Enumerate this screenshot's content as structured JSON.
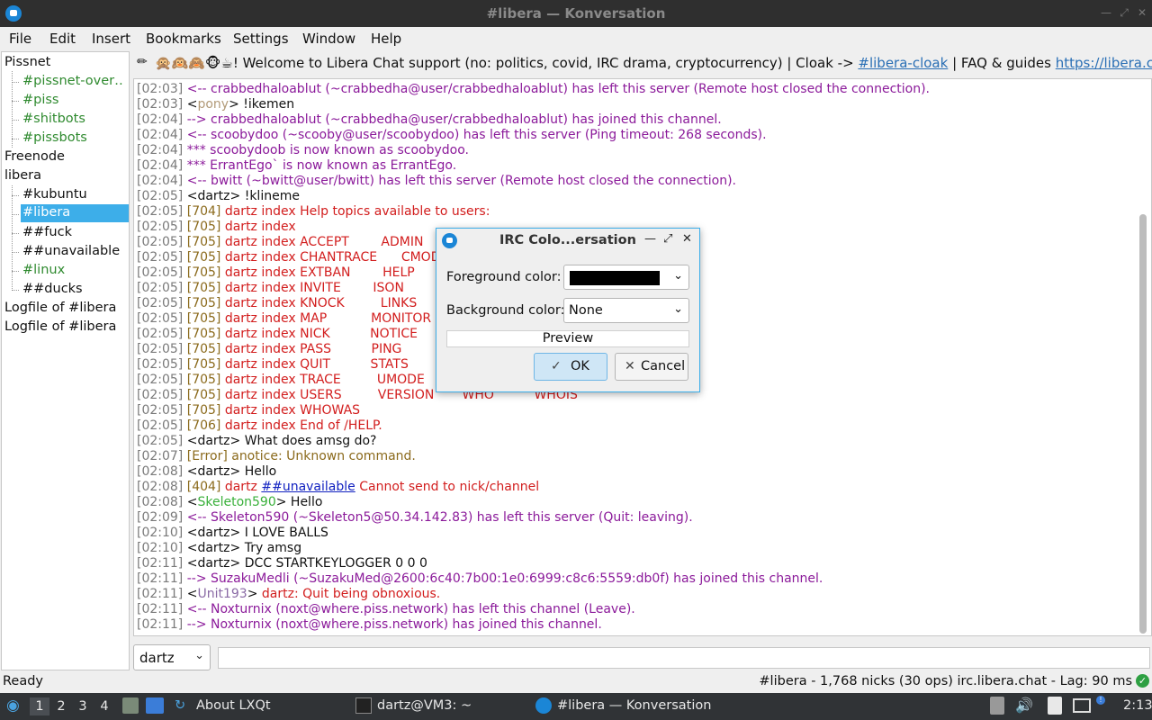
{
  "window": {
    "title": "#libera — Konversation"
  },
  "menu": [
    "File",
    "Edit",
    "Insert",
    "Bookmarks",
    "Settings",
    "Window",
    "Help"
  ],
  "tree": {
    "pissnet": "Pissnet",
    "pissnet_items": [
      "#pissnet-over…",
      "#piss",
      "#shitbots",
      "#pissbots"
    ],
    "freenode": "Freenode",
    "libera": "libera",
    "libera_items": [
      "#kubuntu",
      "#libera",
      "##fuck",
      "##unavailable",
      "#linux",
      "##ducks"
    ],
    "logfile1": "Logfile of #libera",
    "logfile2": "Logfile of #libera"
  },
  "topic": {
    "prefix": "🙊🙉🙈🐵☕! Welcome to Libera Chat support (no: politics, covid, IRC drama, cryptocurrency) | Cloak -> ",
    "cloak_link": "#libera-cloak",
    "middle": " | FAQ & guides ",
    "url": "https://libera.chat/guides/fa..."
  },
  "chat": [
    {
      "ts": "[02:03]",
      "segs": [
        {
          "t": "<-- crabbedhaloablut (~crabbedha@user/crabbedhaloablut) has left this server (Remote host closed the connection).",
          "c": "c-purple"
        }
      ]
    },
    {
      "ts": "[02:03]",
      "segs": [
        {
          "t": "<",
          "c": "c-black"
        },
        {
          "t": "pony",
          "c": "c-pony"
        },
        {
          "t": "> !ikemen",
          "c": "c-black"
        }
      ]
    },
    {
      "ts": "[02:04]",
      "segs": [
        {
          "t": "--> crabbedhaloablut (~crabbedha@user/crabbedhaloablut) has joined this channel.",
          "c": "c-purple"
        }
      ]
    },
    {
      "ts": "[02:04]",
      "segs": [
        {
          "t": "<-- scoobydoo (~scooby@user/scoobydoo) has left this server (Ping timeout: 268 seconds).",
          "c": "c-purple"
        }
      ]
    },
    {
      "ts": "[02:04]",
      "segs": [
        {
          "t": "*** scoobydoob is now known as scoobydoo.",
          "c": "c-purple"
        }
      ]
    },
    {
      "ts": "[02:04]",
      "segs": [
        {
          "t": "*** ErrantEgo` is now known as ErrantEgo.",
          "c": "c-purple"
        }
      ]
    },
    {
      "ts": "[02:04]",
      "segs": [
        {
          "t": "<-- bwitt (~bwitt@user/bwitt) has left this server (Remote host closed the connection).",
          "c": "c-purple"
        }
      ]
    },
    {
      "ts": "[02:05]",
      "segs": [
        {
          "t": "<dartz> !klineme",
          "c": "c-black"
        }
      ]
    },
    {
      "ts": "[02:05]",
      "segs": [
        {
          "t": "[704]",
          "c": "c-olive"
        },
        {
          "t": " dartz index Help topics available to users:",
          "c": "c-red"
        }
      ]
    },
    {
      "ts": "[02:05]",
      "segs": [
        {
          "t": "[705]",
          "c": "c-olive"
        },
        {
          "t": " dartz index",
          "c": "c-red"
        }
      ]
    },
    {
      "ts": "[02:05]",
      "segs": [
        {
          "t": "[705]",
          "c": "c-olive"
        },
        {
          "t": " dartz index ACCEPT        ADMIN",
          "c": "c-red"
        }
      ]
    },
    {
      "ts": "[02:05]",
      "segs": [
        {
          "t": "[705]",
          "c": "c-olive"
        },
        {
          "t": " dartz index CHANTRACE      CMODE",
          "c": "c-red"
        }
      ]
    },
    {
      "ts": "[02:05]",
      "segs": [
        {
          "t": "[705]",
          "c": "c-olive"
        },
        {
          "t": " dartz index EXTBAN        HELP",
          "c": "c-red"
        }
      ]
    },
    {
      "ts": "[02:05]",
      "segs": [
        {
          "t": "[705]",
          "c": "c-olive"
        },
        {
          "t": " dartz index INVITE        ISON",
          "c": "c-red"
        }
      ]
    },
    {
      "ts": "[02:05]",
      "segs": [
        {
          "t": "[705]",
          "c": "c-olive"
        },
        {
          "t": " dartz index KNOCK         LINKS",
          "c": "c-red"
        }
      ]
    },
    {
      "ts": "[02:05]",
      "segs": [
        {
          "t": "[705]",
          "c": "c-olive"
        },
        {
          "t": " dartz index MAP           MONITOR",
          "c": "c-red"
        }
      ]
    },
    {
      "ts": "[02:05]",
      "segs": [
        {
          "t": "[705]",
          "c": "c-olive"
        },
        {
          "t": " dartz index NICK          NOTICE",
          "c": "c-red"
        }
      ]
    },
    {
      "ts": "[02:05]",
      "segs": [
        {
          "t": "[705]",
          "c": "c-olive"
        },
        {
          "t": " dartz index PASS          PING",
          "c": "c-red"
        }
      ]
    },
    {
      "ts": "[02:05]",
      "segs": [
        {
          "t": "[705]",
          "c": "c-olive"
        },
        {
          "t": " dartz index QUIT          STATS",
          "c": "c-red"
        }
      ]
    },
    {
      "ts": "[02:05]",
      "segs": [
        {
          "t": "[705]",
          "c": "c-olive"
        },
        {
          "t": " dartz index TRACE         UMODE",
          "c": "c-red"
        }
      ]
    },
    {
      "ts": "[02:05]",
      "segs": [
        {
          "t": "[705]",
          "c": "c-olive"
        },
        {
          "t": " dartz index USERS         VERSION       WHO          WHOIS",
          "c": "c-red"
        }
      ]
    },
    {
      "ts": "[02:05]",
      "segs": [
        {
          "t": "[705]",
          "c": "c-olive"
        },
        {
          "t": " dartz index WHOWAS",
          "c": "c-red"
        }
      ]
    },
    {
      "ts": "[02:05]",
      "segs": [
        {
          "t": "[706]",
          "c": "c-olive"
        },
        {
          "t": " dartz index End of /HELP.",
          "c": "c-red"
        }
      ]
    },
    {
      "ts": "[02:05]",
      "segs": [
        {
          "t": "<dartz> What does amsg do?",
          "c": "c-black"
        }
      ]
    },
    {
      "ts": "[02:07]",
      "segs": [
        {
          "t": "[Error] anotice: Unknown command.",
          "c": "c-olive"
        }
      ]
    },
    {
      "ts": "[02:08]",
      "segs": [
        {
          "t": "<dartz> Hello",
          "c": "c-black"
        }
      ]
    },
    {
      "ts": "[02:08]",
      "segs": [
        {
          "t": "[404]",
          "c": "c-olive"
        },
        {
          "t": " dartz ",
          "c": "c-red"
        },
        {
          "t": "##unavailable",
          "c": "c-link"
        },
        {
          "t": " Cannot send to nick/channel",
          "c": "c-red"
        }
      ]
    },
    {
      "ts": "[02:08]",
      "segs": [
        {
          "t": "<",
          "c": "c-black"
        },
        {
          "t": "Skeleton590",
          "c": "c-green"
        },
        {
          "t": "> Hello",
          "c": "c-black"
        }
      ]
    },
    {
      "ts": "[02:09]",
      "segs": [
        {
          "t": "<-- Skeleton590 (~Skeleton5@50.34.142.83) has left this server (Quit: leaving).",
          "c": "c-purple"
        }
      ]
    },
    {
      "ts": "[02:10]",
      "segs": [
        {
          "t": "<dartz> I LOVE BALLS",
          "c": "c-black"
        }
      ]
    },
    {
      "ts": "[02:10]",
      "segs": [
        {
          "t": "<dartz> Try amsg",
          "c": "c-black"
        }
      ]
    },
    {
      "ts": "[02:11]",
      "segs": [
        {
          "t": "<dartz> DCC STARTKEYLOGGER 0 0 0",
          "c": "c-black"
        }
      ]
    },
    {
      "ts": "[02:11]",
      "segs": [
        {
          "t": "--> SuzakuMedli (~SuzakuMed@2600:6c40:7b00:1e0:6999:c8c6:5559:db0f) has joined this channel.",
          "c": "c-purple"
        }
      ]
    },
    {
      "ts": "[02:11]",
      "segs": [
        {
          "t": "<",
          "c": "c-black"
        },
        {
          "t": "Unit193",
          "c": "c-unit"
        },
        {
          "t": "> ",
          "c": "c-black"
        },
        {
          "t": "dartz: Quit being obnoxious.",
          "c": "c-red"
        }
      ]
    },
    {
      "ts": "[02:11]",
      "segs": [
        {
          "t": "<-- Noxturnix (noxt@where.piss.network) has left this channel (Leave).",
          "c": "c-purple"
        }
      ]
    },
    {
      "ts": "[02:11]",
      "segs": [
        {
          "t": "--> Noxturnix (noxt@where.piss.network) has joined this channel.",
          "c": "c-purple"
        }
      ]
    }
  ],
  "input": {
    "nick": "dartz",
    "text": ""
  },
  "status": {
    "left": "Ready",
    "right": "#libera - 1,768 nicks (30 ops)  irc.libera.chat - Lag: 90 ms"
  },
  "dialog": {
    "title": "IRC Colo...ersation",
    "fg_label": "Foreground color:",
    "fg_color": "#000000",
    "bg_label": "Background color:",
    "bg_value": "None",
    "preview": "Preview",
    "ok": "OK",
    "cancel": "Cancel"
  },
  "taskbar": {
    "desktops": [
      "1",
      "2",
      "3",
      "4"
    ],
    "about": "About LXQt",
    "terminal": "dartz@VM3: ~",
    "konversation": "#libera — Konversation",
    "clock": "2:13"
  }
}
